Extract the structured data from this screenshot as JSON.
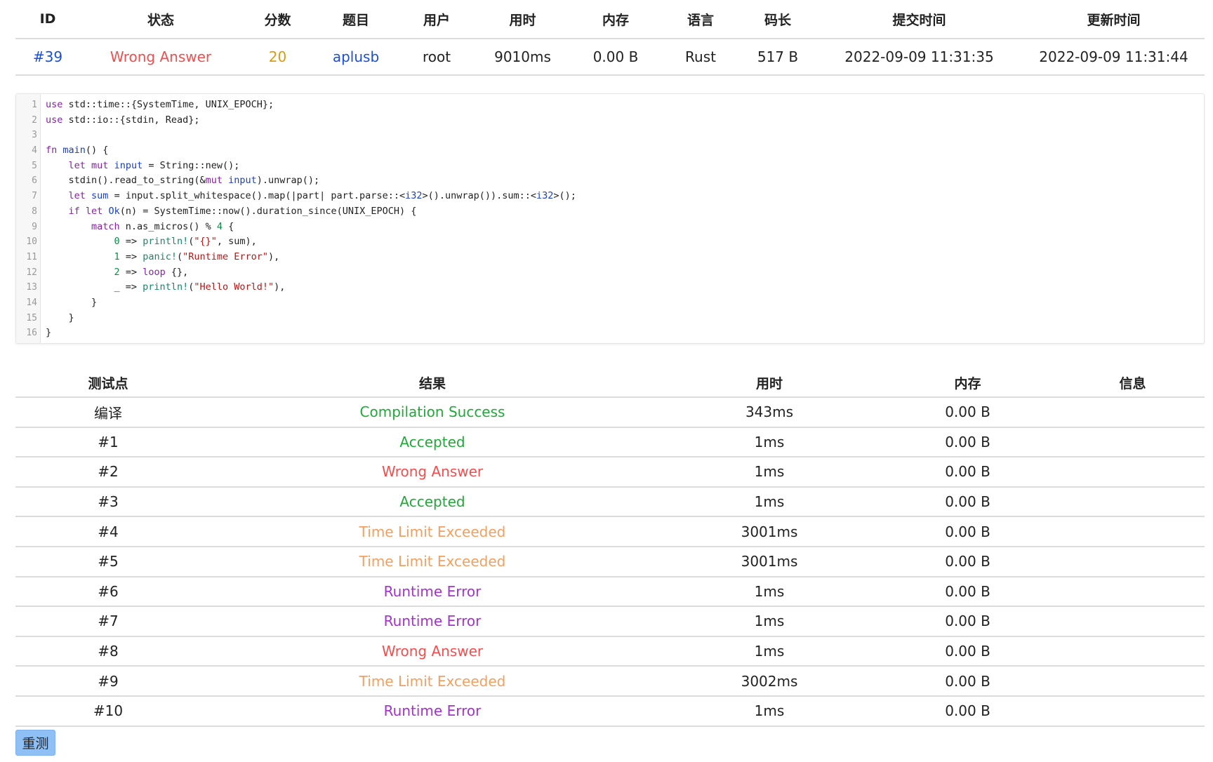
{
  "submission": {
    "headers": [
      "ID",
      "状态",
      "分数",
      "题目",
      "用户",
      "用时",
      "内存",
      "语言",
      "码长",
      "提交时间",
      "更新时间"
    ],
    "row": {
      "id": "#39",
      "status": "Wrong Answer",
      "score": "20",
      "problem": "aplusb",
      "user": "root",
      "time": "9010ms",
      "memory": "0.00 B",
      "language": "Rust",
      "code_length": "517 B",
      "submit_time": "2022-09-09 11:31:35",
      "update_time": "2022-09-09 11:31:44"
    }
  },
  "code": {
    "lines": [
      "use std::time::{SystemTime, UNIX_EPOCH};",
      "use std::io::{stdin, Read};",
      "",
      "fn main() {",
      "    let mut input = String::new();",
      "    stdin().read_to_string(&mut input).unwrap();",
      "    let sum = input.split_whitespace().map(|part| part.parse::<i32>().unwrap()).sum::<i32>();",
      "    if let Ok(n) = SystemTime::now().duration_since(UNIX_EPOCH) {",
      "        match n.as_micros() % 4 {",
      "            0 => println!(\"{}\", sum),",
      "            1 => panic!(\"Runtime Error\"),",
      "            2 => loop {},",
      "            _ => println!(\"Hello World!\"),",
      "        }",
      "    }",
      "}"
    ]
  },
  "tests": {
    "headers": [
      "测试点",
      "结果",
      "用时",
      "内存",
      "信息"
    ],
    "rows": [
      {
        "name": "编译",
        "result": "Compilation Success",
        "kind": "ac",
        "time": "343ms",
        "memory": "0.00 B",
        "info": ""
      },
      {
        "name": "#1",
        "result": "Accepted",
        "kind": "ac",
        "time": "1ms",
        "memory": "0.00 B",
        "info": ""
      },
      {
        "name": "#2",
        "result": "Wrong Answer",
        "kind": "wa",
        "time": "1ms",
        "memory": "0.00 B",
        "info": ""
      },
      {
        "name": "#3",
        "result": "Accepted",
        "kind": "ac",
        "time": "1ms",
        "memory": "0.00 B",
        "info": ""
      },
      {
        "name": "#4",
        "result": "Time Limit Exceeded",
        "kind": "tle",
        "time": "3001ms",
        "memory": "0.00 B",
        "info": ""
      },
      {
        "name": "#5",
        "result": "Time Limit Exceeded",
        "kind": "tle",
        "time": "3001ms",
        "memory": "0.00 B",
        "info": ""
      },
      {
        "name": "#6",
        "result": "Runtime Error",
        "kind": "re",
        "time": "1ms",
        "memory": "0.00 B",
        "info": ""
      },
      {
        "name": "#7",
        "result": "Runtime Error",
        "kind": "re",
        "time": "1ms",
        "memory": "0.00 B",
        "info": ""
      },
      {
        "name": "#8",
        "result": "Wrong Answer",
        "kind": "wa",
        "time": "1ms",
        "memory": "0.00 B",
        "info": ""
      },
      {
        "name": "#9",
        "result": "Time Limit Exceeded",
        "kind": "tle",
        "time": "3002ms",
        "memory": "0.00 B",
        "info": ""
      },
      {
        "name": "#10",
        "result": "Runtime Error",
        "kind": "re",
        "time": "1ms",
        "memory": "0.00 B",
        "info": ""
      }
    ]
  },
  "actions": {
    "rejudge_label": "重测"
  },
  "colors": {
    "accepted": "#22a83a",
    "wrong_answer": "#ef4f4f",
    "time_limit": "#f0a061",
    "runtime_error": "#a630d0",
    "link": "#1a4fd6",
    "score_partial": "#d99b14",
    "button": "#8ec0f5"
  }
}
